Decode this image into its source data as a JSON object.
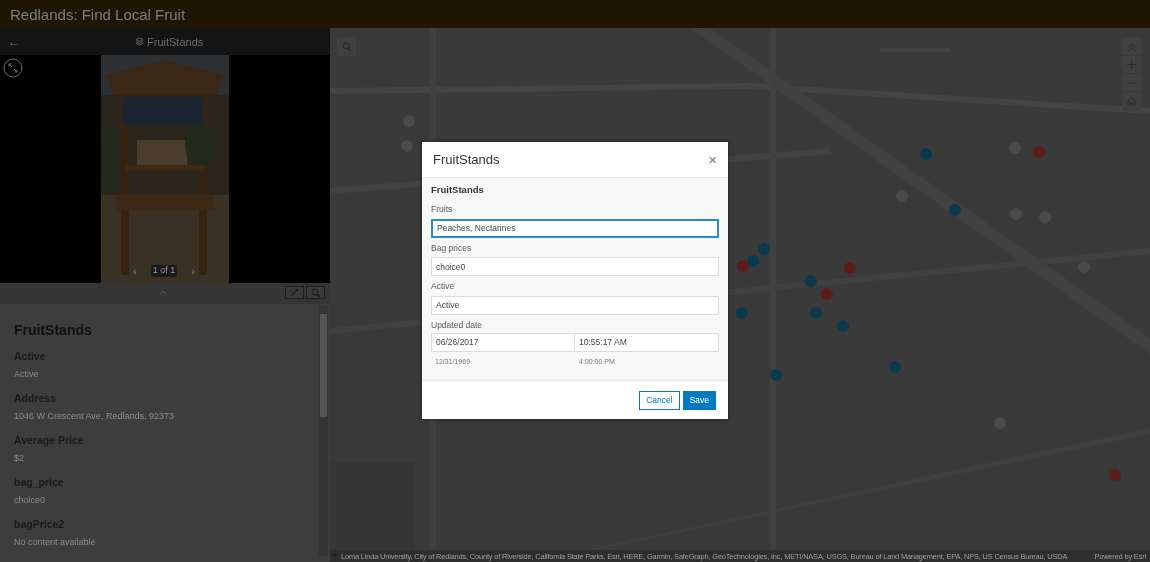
{
  "app": {
    "title": "Redlands: Find Local Fruit"
  },
  "panel": {
    "back": "←",
    "layer": "FruitStands",
    "pager": {
      "prev": "‹",
      "text": "1 of 1",
      "next": "›"
    },
    "title": "FruitStands",
    "fields": [
      {
        "label": "Active",
        "value": "Active"
      },
      {
        "label": "Address",
        "value": "1046 W Crescent Ave, Redlands, 92373"
      },
      {
        "label": "Average Price",
        "value": "$2"
      },
      {
        "label": "bag_price",
        "value": "choice0"
      },
      {
        "label": "bagPrice2",
        "value": "No content available"
      }
    ]
  },
  "map": {
    "markers": [
      {
        "color": "#4a4a4a"
      },
      {
        "color": "#4a4a4a"
      },
      {
        "color": "#0b3a4e"
      },
      {
        "color": "#5c1c1c"
      },
      {
        "color": "#4a4a4a"
      },
      {
        "color": "#4a4a4a"
      },
      {
        "color": "#0b3a4e"
      },
      {
        "color": "#4a4a4a"
      },
      {
        "color": "#4a4a4a"
      },
      {
        "color": "#4a4a4a"
      },
      {
        "color": "#0b3a4e"
      },
      {
        "color": "#0b3a4e"
      },
      {
        "color": "#5c1c1c"
      },
      {
        "color": "#5c1c1c"
      },
      {
        "color": "#0b3a4e"
      },
      {
        "color": "#5c1c1c"
      },
      {
        "color": "#0b3a4e"
      },
      {
        "color": "#0b3a4e"
      },
      {
        "color": "#0b3a4e"
      },
      {
        "color": "#0b3a4e"
      },
      {
        "color": "#0b3a4e"
      },
      {
        "color": "#4a4a4a"
      },
      {
        "color": "#5c1c1c"
      }
    ],
    "attribution": "Loma Linda University, City of Redlands, County of Riverside, California State Parks, Esri, HERE, Garmin, SafeGraph, GeoTechnologies, Inc, METI/NASA, USGS, Bureau of Land Management, EPA, NPS, US Census Bureau, USDA",
    "powered_by": "Powered by Esri"
  },
  "dialog": {
    "title": "FruitStands",
    "close": "×",
    "section": "FruitStands",
    "fields": [
      {
        "kind": "text",
        "label": "Fruits",
        "value": "Peaches, Nectarines",
        "focused": true
      },
      {
        "kind": "text",
        "label": "Bag prices",
        "value": "choice0",
        "focused": false
      },
      {
        "kind": "text",
        "label": "Active",
        "value": "Active",
        "focused": false
      },
      {
        "kind": "datetime",
        "label": "Updated date",
        "date": "06/26/2017",
        "time": "10:55:17 AM",
        "date_hint": "12/31/1969",
        "time_hint": "4:00:00 PM"
      }
    ],
    "buttons": [
      {
        "label": "Cancel",
        "kind": "secondary"
      },
      {
        "label": "Save",
        "kind": "primary"
      }
    ]
  }
}
